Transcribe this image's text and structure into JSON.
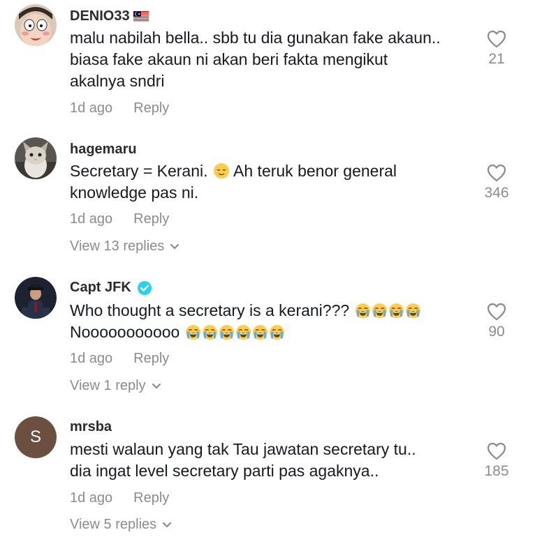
{
  "comments": [
    {
      "username": "DENIO33",
      "flag_icon": "malaysia-flag-icon",
      "lines": [
        "malu nabilah bella.. sbb tu dia gunakan fake akaun..",
        "biasa fake akaun ni akan beri fakta mengikut",
        "akalnya sndri"
      ],
      "time": "1d ago",
      "reply_label": "Reply",
      "likes": "21",
      "view_replies": ""
    },
    {
      "username": "hagemaru",
      "lines": [
        "Secretary = Kerani.",
        "Ah teruk benor general",
        "knowledge pas ni."
      ],
      "emoji_icon": "relieved-face-emoji",
      "time": "1d ago",
      "reply_label": "Reply",
      "likes": "346",
      "view_replies": "View 13 replies"
    },
    {
      "username": "Capt JFK",
      "verified_icon": "verified-badge-icon",
      "lines": [
        "Who thought a secretary is a kerani???",
        "Nooooooooooo"
      ],
      "emoji_icon": "loudly-crying-face-emoji",
      "emoji_counts": [
        4,
        6
      ],
      "time": "1d ago",
      "reply_label": "Reply",
      "likes": "90",
      "view_replies": "View 1 reply"
    },
    {
      "username": "mrsba",
      "avatar_letter": "S",
      "avatar_color": "#6b4f3f",
      "lines": [
        "mesti walaun yang tak Tau jawatan secretary tu..",
        "dia ingat level secretary parti pas agaknya.."
      ],
      "time": "1d ago",
      "reply_label": "Reply",
      "likes": "185",
      "view_replies": "View 5 replies"
    }
  ],
  "colors": {
    "primary_text": "#161823",
    "secondary_text": "#8a8b91",
    "verified": "#20d5ec"
  }
}
